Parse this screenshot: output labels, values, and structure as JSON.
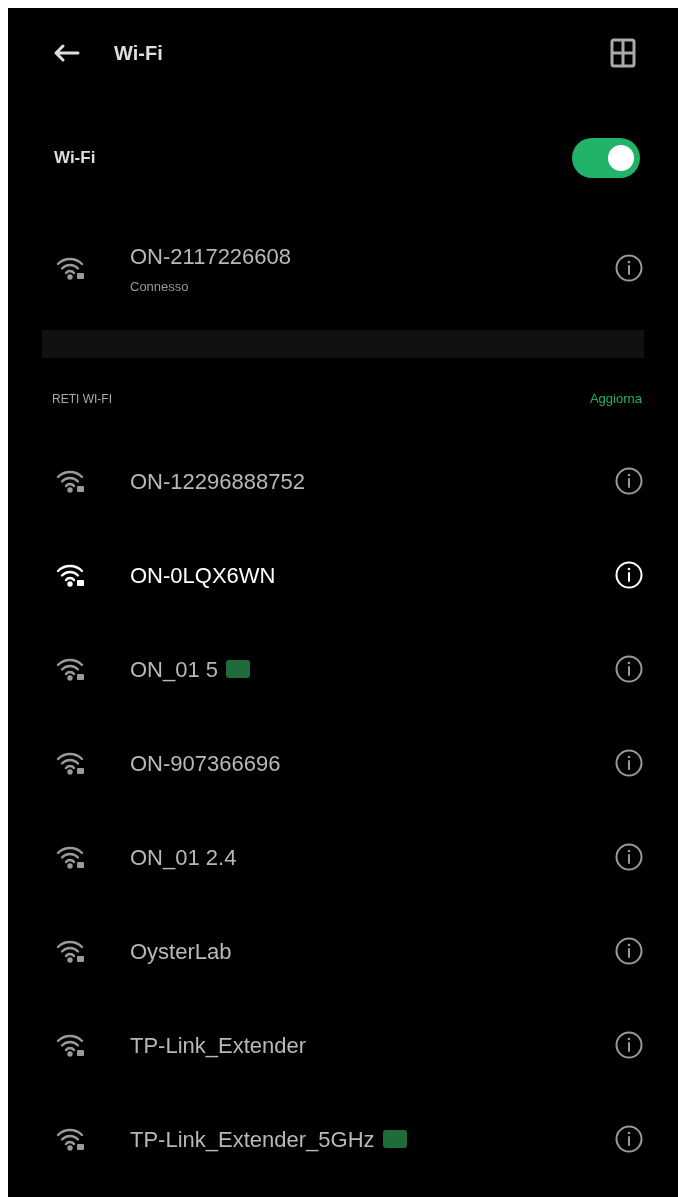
{
  "header": {
    "title": "Wi-Fi"
  },
  "wifi_toggle": {
    "label": "Wi-Fi",
    "on": true
  },
  "connected": {
    "name": "ON-2117226608",
    "status": "Connesso",
    "blurred": true
  },
  "section": {
    "title": "RETI WI-FI",
    "action": "Aggiorna"
  },
  "networks": [
    {
      "name": "ON-12296888752",
      "blurred": true,
      "badge": false
    },
    {
      "name": "ON-0LQX6WN",
      "blurred": false,
      "badge": false
    },
    {
      "name": "ON_01 5",
      "blurred": true,
      "badge": true
    },
    {
      "name": "ON-907366696",
      "blurred": true,
      "badge": false
    },
    {
      "name": "ON_01 2.4",
      "blurred": true,
      "badge": false
    },
    {
      "name": "OysterLab",
      "blurred": true,
      "badge": false
    },
    {
      "name": "TP-Link_Extender",
      "blurred": true,
      "badge": false
    },
    {
      "name": "TP-Link_Extender_5GHz",
      "blurred": true,
      "badge": true
    }
  ]
}
